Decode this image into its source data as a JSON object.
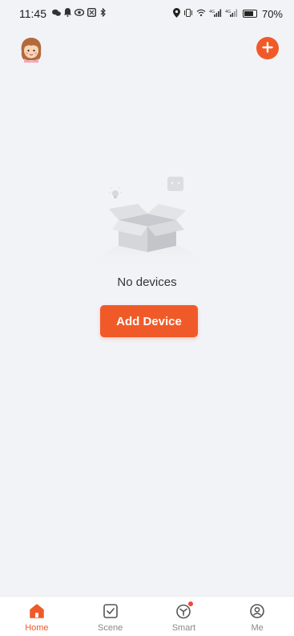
{
  "status_bar": {
    "time": "11:45",
    "battery_percent": "70%",
    "left_icons": [
      "chat-bubble-icon",
      "notification-bell-icon",
      "eye-icon",
      "alarm-icon",
      "bluetooth-icon"
    ],
    "right_icons": [
      "location-pin-icon",
      "vibrate-icon",
      "wifi-icon",
      "cell-signal-1-icon",
      "cell-signal-2-icon",
      "battery-icon"
    ]
  },
  "header": {
    "avatar_icon": "avatar-girl-icon",
    "add_icon": "plus-icon"
  },
  "empty_state": {
    "illustration_icon": "empty-box-icon",
    "message": "No devices",
    "button_label": "Add Device"
  },
  "nav": {
    "items": [
      {
        "label": "Home",
        "icon": "home-icon",
        "active": true
      },
      {
        "label": "Scene",
        "icon": "checkbox-icon",
        "active": false
      },
      {
        "label": "Smart",
        "icon": "smart-icon",
        "active": false,
        "badge": true
      },
      {
        "label": "Me",
        "icon": "profile-icon",
        "active": false
      }
    ]
  },
  "colors": {
    "accent": "#f05a28",
    "background": "#f2f3f7",
    "nav_background": "#ffffff",
    "inactive_label": "#888888"
  }
}
